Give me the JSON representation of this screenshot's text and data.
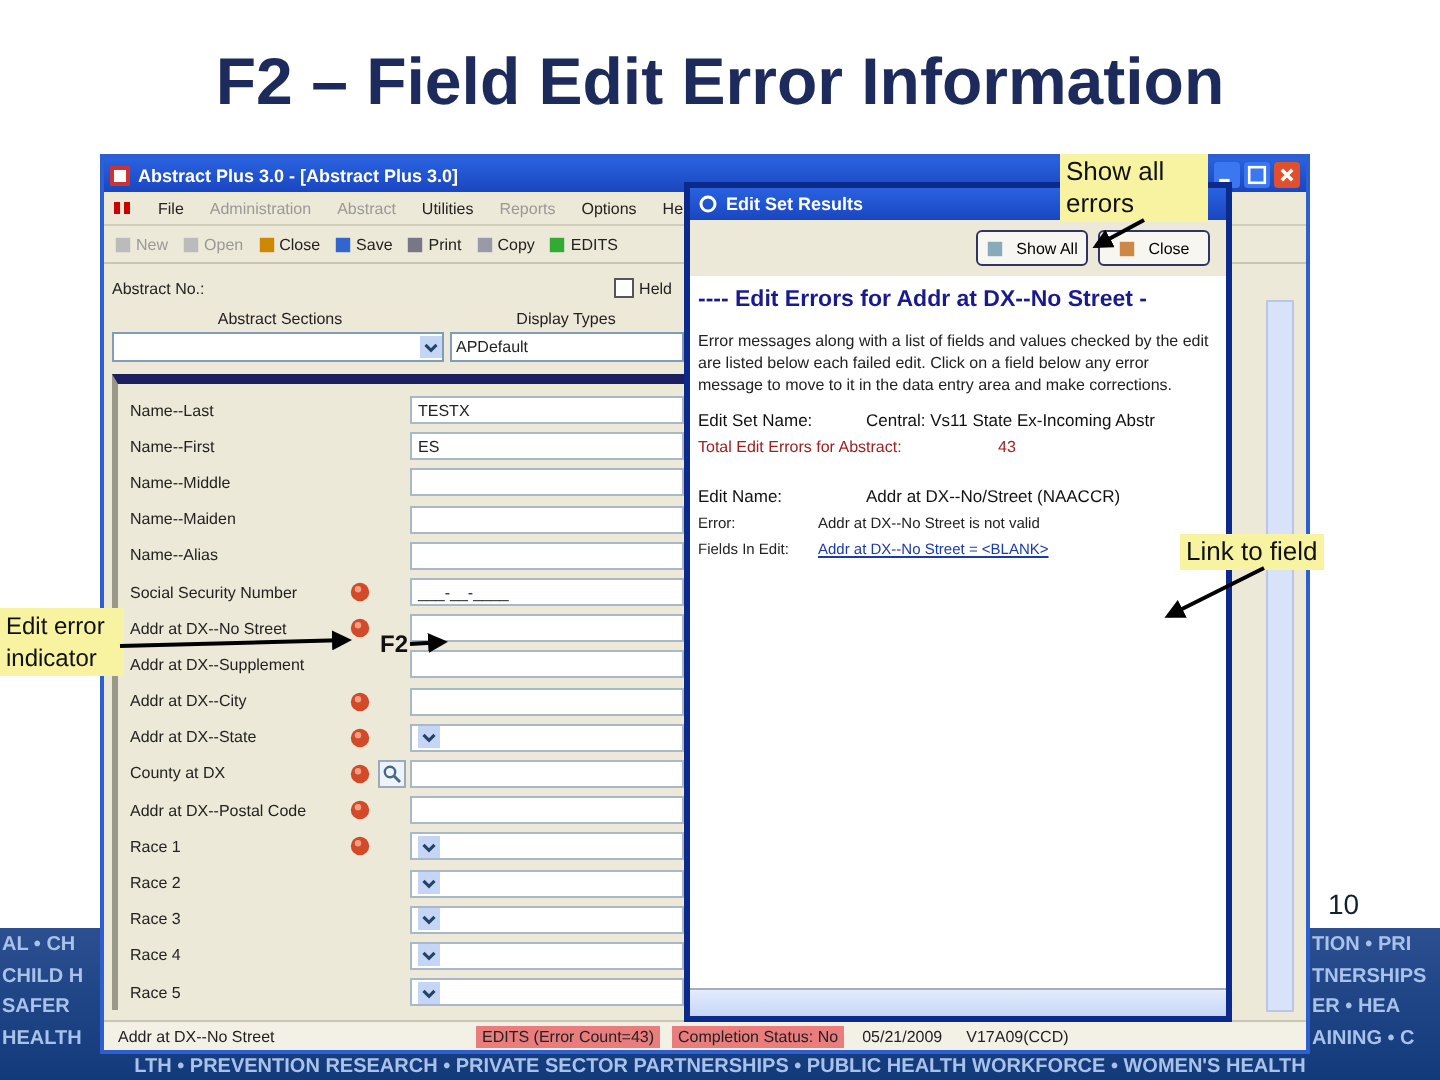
{
  "slide": {
    "title": "F2 – Field Edit Error Information",
    "page_number": "10"
  },
  "window": {
    "title": "Abstract Plus 3.0 - [Abstract Plus 3.0]",
    "menu": [
      {
        "label": "File",
        "disabled": false
      },
      {
        "label": "Administration",
        "disabled": true
      },
      {
        "label": "Abstract",
        "disabled": true
      },
      {
        "label": "Utilities",
        "disabled": false
      },
      {
        "label": "Reports",
        "disabled": true
      },
      {
        "label": "Options",
        "disabled": false
      },
      {
        "label": "He",
        "disabled": false
      }
    ],
    "toolbar": [
      {
        "label": "New",
        "disabled": true
      },
      {
        "label": "Open",
        "disabled": true
      },
      {
        "label": "Close",
        "disabled": false
      },
      {
        "label": "Save",
        "disabled": false
      },
      {
        "label": "Print",
        "disabled": false
      },
      {
        "label": "Copy",
        "disabled": false
      },
      {
        "label": "EDITS",
        "disabled": false
      }
    ],
    "abstract_no_label": "Abstract No.:",
    "held": {
      "label": "Held",
      "checked": false
    },
    "sections_label": "Abstract Sections",
    "display_types_label": "Display Types",
    "display_type_value": "APDefault",
    "fields": [
      {
        "label": "Name--Last",
        "value": "TESTX",
        "kind": "text",
        "error": false
      },
      {
        "label": "Name--First",
        "value": "ES",
        "kind": "text",
        "error": false
      },
      {
        "label": "Name--Middle",
        "kind": "text",
        "error": false
      },
      {
        "label": "Name--Maiden",
        "kind": "text",
        "error": false
      },
      {
        "label": "Name--Alias",
        "kind": "text",
        "error": false
      },
      {
        "label": "Social Security Number",
        "value": "___-__-____",
        "kind": "text",
        "error": true
      },
      {
        "label": "Addr at DX--No Street",
        "kind": "text",
        "error": true
      },
      {
        "label": "Addr at DX--Supplement",
        "kind": "text",
        "error": false
      },
      {
        "label": "Addr at DX--City",
        "kind": "text",
        "error": true
      },
      {
        "label": "Addr at DX--State",
        "kind": "dropdown",
        "error": true
      },
      {
        "label": "County at DX",
        "kind": "lookup",
        "error": true
      },
      {
        "label": "Addr at DX--Postal Code",
        "kind": "text",
        "error": true
      },
      {
        "label": "Race 1",
        "kind": "dropdown",
        "error": true
      },
      {
        "label": "Race 2",
        "kind": "dropdown",
        "error": false
      },
      {
        "label": "Race 3",
        "kind": "dropdown",
        "error": false
      },
      {
        "label": "Race 4",
        "kind": "dropdown",
        "error": false
      },
      {
        "label": "Race 5",
        "kind": "dropdown",
        "error": false
      }
    ],
    "status_bar": [
      {
        "text": "Addr at DX--No Street",
        "alert": false
      },
      {
        "text": "EDITS (Error Count=43)",
        "alert": true
      },
      {
        "text": "Completion Status: No",
        "alert": true
      },
      {
        "text": "05/21/2009",
        "alert": false
      },
      {
        "text": "V17A09(CCD)",
        "alert": false
      }
    ]
  },
  "dialog": {
    "title": "Edit Set Results",
    "buttons": [
      "Show All",
      "Close"
    ],
    "heading": "---- Edit Errors for Addr at DX--No  Street -",
    "intro": "Error messages along with a list of fields and values checked by the edit are listed below each failed edit. Click on a field below any error message to move to it in the data entry area and make corrections.",
    "edit_set_label": "Edit Set Name:",
    "edit_set_value": "Central: Vs11 State Ex-Incoming Abstr",
    "total_label": "Total Edit Errors for Abstract:",
    "total_value": "43",
    "edit_name_label": "Edit Name:",
    "edit_name_value": "Addr at DX--No/Street (NAACCR)",
    "error_label": "Error:",
    "error_value": "Addr at DX--No Street is not valid",
    "fields_label": "Fields In Edit:",
    "field_link": "Addr at DX--No Street = <BLANK>"
  },
  "callouts": [
    {
      "kind": "show_all",
      "text": "Show all errors"
    },
    {
      "kind": "link",
      "text": "Link to field"
    },
    {
      "kind": "indicator",
      "text": "Edit error indicator"
    },
    {
      "kind": "f2",
      "text": "F2"
    }
  ],
  "banner": {
    "rows": [
      {
        "left": "AL • CH",
        "right": "TION • PRI"
      },
      {
        "left": "CHILD H",
        "right": "TNERSHIPS"
      },
      {
        "left": "SAFER",
        "right": "ER • HEA"
      },
      {
        "left": "HEALTH",
        "right": "AINING • C"
      }
    ],
    "bottom": "LTH • PREVENTION RESEARCH • PRIVATE SECTOR PARTNERSHIPS • PUBLIC HEALTH WORKFORCE • WOMEN'S HEALTH"
  }
}
